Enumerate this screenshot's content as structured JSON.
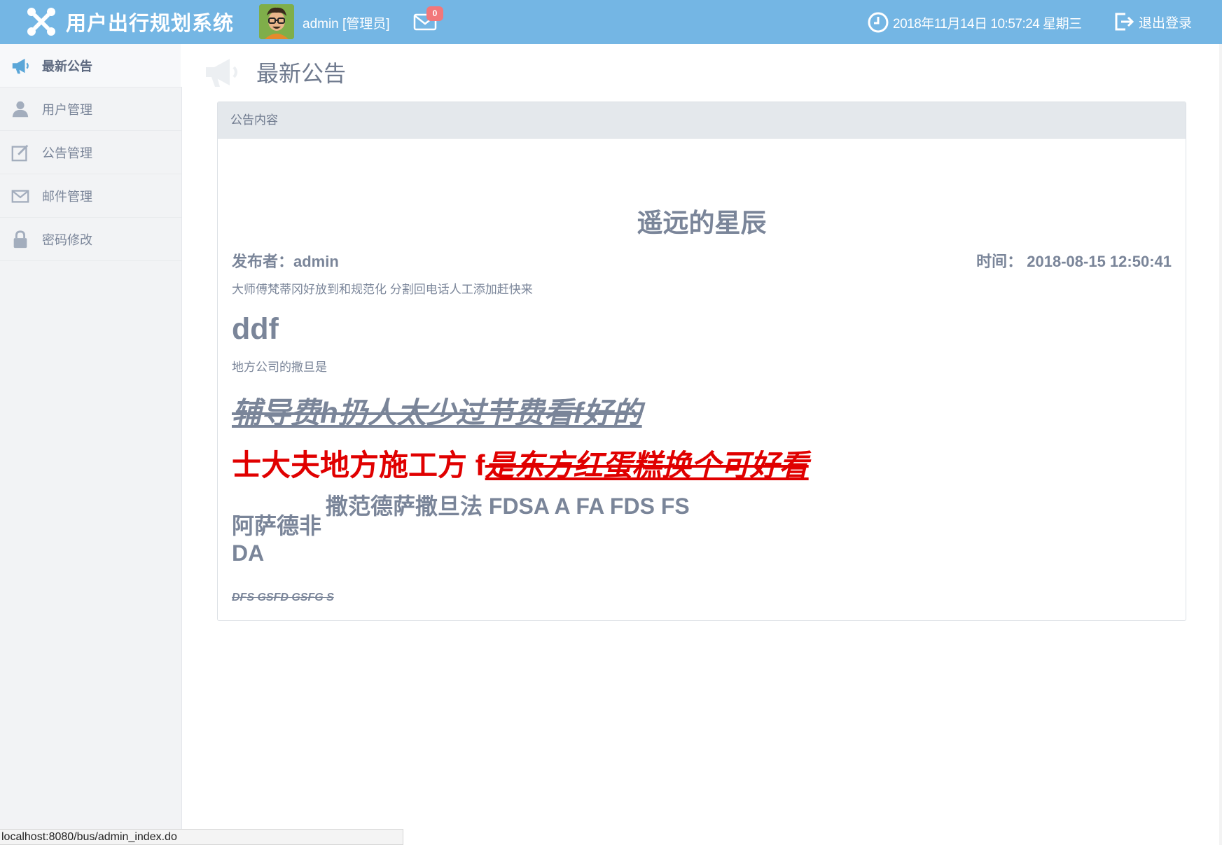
{
  "header": {
    "app_title": "用户出行规划系统",
    "user_label": "admin [管理员]",
    "mail_count": "0",
    "datetime": "2018年11月14日 10:57:24 星期三",
    "logout_label": "退出登录"
  },
  "sidebar": {
    "items": [
      {
        "label": "最新公告",
        "icon": "megaphone-icon",
        "active": true
      },
      {
        "label": "用户管理",
        "icon": "user-icon",
        "active": false
      },
      {
        "label": "公告管理",
        "icon": "edit-icon",
        "active": false
      },
      {
        "label": "邮件管理",
        "icon": "mail-icon",
        "active": false
      },
      {
        "label": "密码修改",
        "icon": "lock-icon",
        "active": false
      }
    ]
  },
  "main": {
    "page_title": "最新公告",
    "panel_header": "公告内容",
    "notice": {
      "title": "遥远的星辰",
      "publisher": "发布者：admin",
      "time": "时间：  2018-08-15 12:50:41",
      "para1": "大师傅梵蒂冈好放到和规范化 分割回电话人工添加赶快来",
      "heading_ddf": "ddf",
      "para2": "地方公司的撒旦是",
      "strike_heading": "辅导费h扔人太少过节费看f好的",
      "red_plain": "士大夫地方施工方 f",
      "red_emphasis": "是东方红蛋糕换个可好看",
      "mixed_a": "阿萨德非",
      "mixed_b": "撒范德萨撒旦法 FDSA A FA FDS FS",
      "mixed_c": "DA",
      "small_strike": "DFS GSFD GSFG S"
    }
  },
  "statusbar": {
    "url": "localhost:8080/bus/admin_index.do"
  },
  "colors": {
    "header_bg": "#74b6e4",
    "sidebar_bg": "#f2f3f5",
    "text_gray": "#7a8599",
    "red": "#e00000",
    "badge": "#f2777a"
  }
}
